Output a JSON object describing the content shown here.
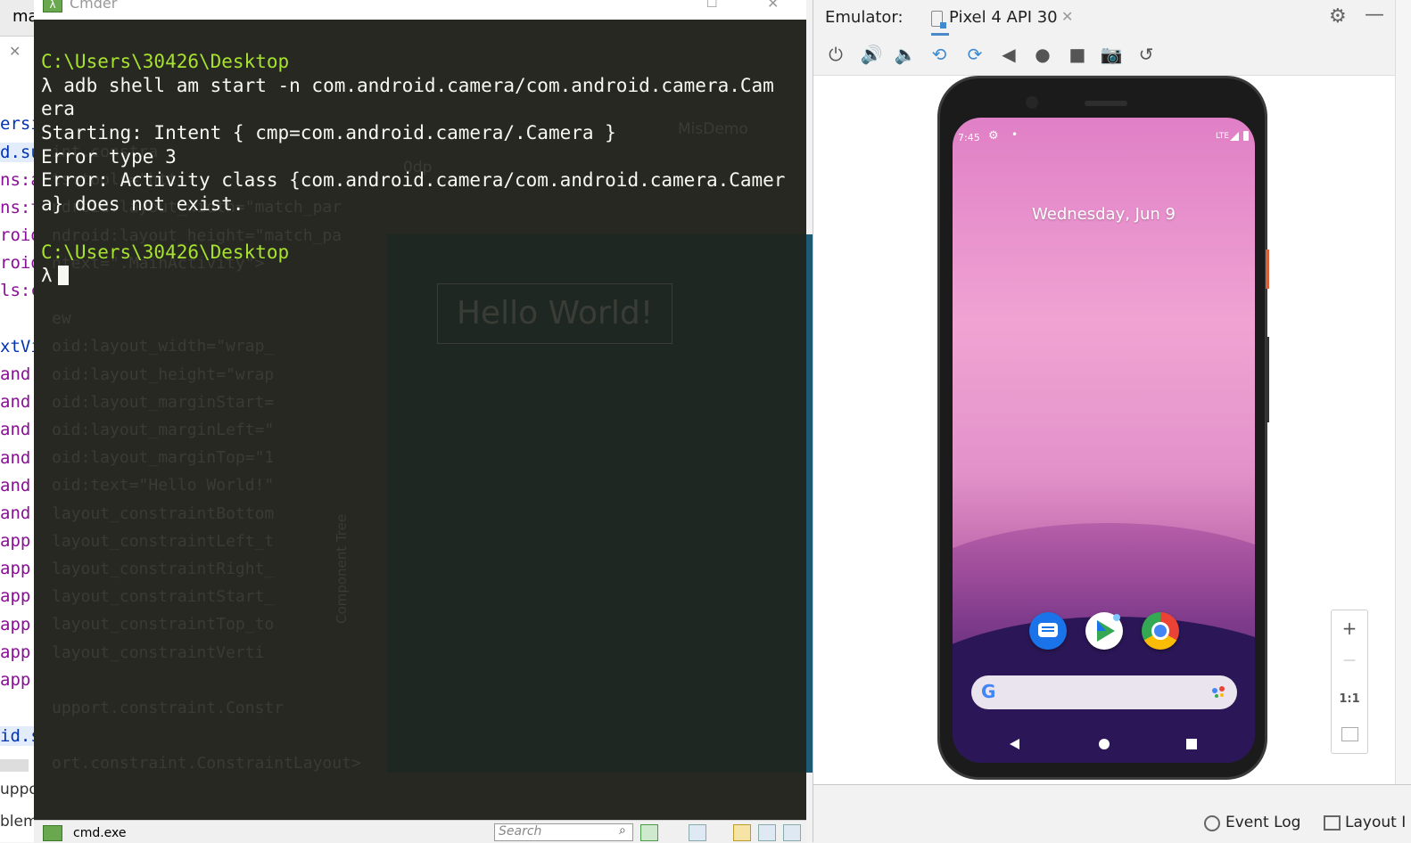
{
  "ide": {
    "tab_label": "ma",
    "tab_close": "✕",
    "code_fragments": [
      {
        "text": "ersi",
        "color": "#0033b3",
        "hl": false
      },
      {
        "text": "d.su",
        "color": "#0033b3",
        "hl": true
      },
      {
        "text": "ns:a",
        "color": "#871094",
        "hl": false
      },
      {
        "text": "ns:t",
        "color": "#871094",
        "hl": false
      },
      {
        "text": "roid",
        "color": "#871094",
        "hl": false
      },
      {
        "text": "roid",
        "color": "#871094",
        "hl": false
      },
      {
        "text": "ls:c",
        "color": "#871094",
        "hl": false
      },
      {
        "text": "",
        "color": "#000000",
        "hl": false
      },
      {
        "text": "xtVi",
        "color": "#0033b3",
        "hl": false
      },
      {
        "text": "and",
        "color": "#871094",
        "hl": false
      },
      {
        "text": "and",
        "color": "#871094",
        "hl": false
      },
      {
        "text": "and",
        "color": "#871094",
        "hl": false
      },
      {
        "text": "and",
        "color": "#871094",
        "hl": false
      },
      {
        "text": "and",
        "color": "#871094",
        "hl": false
      },
      {
        "text": "and",
        "color": "#871094",
        "hl": false
      },
      {
        "text": "app",
        "color": "#871094",
        "hl": false
      },
      {
        "text": "app",
        "color": "#871094",
        "hl": false
      },
      {
        "text": "app",
        "color": "#871094",
        "hl": false
      },
      {
        "text": "app",
        "color": "#871094",
        "hl": false
      },
      {
        "text": "app",
        "color": "#871094",
        "hl": false
      },
      {
        "text": "app",
        "color": "#871094",
        "hl": false
      },
      {
        "text": "",
        "color": "#000000",
        "hl": false
      },
      {
        "text": "id.s",
        "color": "#0033b3",
        "hl": true
      }
    ],
    "bottom_labels": [
      "uppo",
      "blems"
    ]
  },
  "cmder": {
    "title": "Cmder",
    "max_glyph": "☐",
    "close_glyph": "✕",
    "lines": [
      {
        "text": "C:\\Users\\30426\\Desktop",
        "kind": "path"
      },
      {
        "text": "λ adb shell am start -n com.android.camera/com.android.camera.Cam",
        "kind": "cmd"
      },
      {
        "text": "era",
        "kind": "cmd"
      },
      {
        "text": "Starting: Intent { cmp=com.android.camera/.Camera }",
        "kind": "out"
      },
      {
        "text": "Error type 3",
        "kind": "out"
      },
      {
        "text": "Error: Activity class {com.android.camera/com.android.camera.Camer",
        "kind": "out"
      },
      {
        "text": "a} does not exist.",
        "kind": "out"
      },
      {
        "text": "",
        "kind": "out"
      },
      {
        "text": "C:\\Users\\30426\\Desktop",
        "kind": "path"
      }
    ],
    "prompt": "λ",
    "ghost": {
      "hello": "Hello World!",
      "misdemo": "MisDemo",
      "dp": "0dp",
      "component_tree": "Component Tree",
      "code": [
        "int.constra",
        "ts:tools=\"htt",
        "ndroid:layout_width=\"match_par",
        "ndroid:layout_height=\"match_pa",
        "ntext=\".MainActivity\">",
        "",
        "ew",
        "oid:layout_width=\"wrap_",
        "oid:layout_height=\"wrap",
        "oid:layout_marginStart=",
        "oid:layout_marginLeft=\"",
        "oid:layout_marginTop=\"1",
        "oid:text=\"Hello World!\"",
        "layout_constraintBottom",
        "layout_constraintLeft_t",
        "layout_constraintRight_",
        "layout_constraintStart_",
        "layout_constraintTop_to",
        "layout_constraintVerti",
        "",
        "upport.constraint.Constr",
        "",
        "ort.constraint.ConstraintLayout>"
      ]
    },
    "status": {
      "tab_label": "cmd.exe",
      "search_placeholder": "Search"
    }
  },
  "emulator": {
    "label": "Emulator:",
    "device_tab": "Pixel 4 API 30",
    "tab_close": "✕",
    "settings_glyph": "⚙",
    "minimize_glyph": "—",
    "toolbar": [
      {
        "name": "power-icon",
        "glyph": "⏻",
        "blue": false
      },
      {
        "name": "volume-up-icon",
        "glyph": "🔊",
        "blue": false
      },
      {
        "name": "volume-down-icon",
        "glyph": "🔈",
        "blue": false
      },
      {
        "name": "rotate-left-icon",
        "glyph": "⟲",
        "blue": true
      },
      {
        "name": "rotate-right-icon",
        "glyph": "⟳",
        "blue": true
      },
      {
        "name": "back-icon",
        "glyph": "◀",
        "blue": false
      },
      {
        "name": "home-icon",
        "glyph": "●",
        "blue": false
      },
      {
        "name": "overview-icon",
        "glyph": "■",
        "blue": false
      },
      {
        "name": "camera-icon",
        "glyph": "📷",
        "blue": false
      },
      {
        "name": "snapshot-icon",
        "glyph": "↺",
        "blue": false
      }
    ],
    "phone": {
      "time": "7:45",
      "network": "LTE",
      "date": "Wednesday, Jun 9",
      "apps": [
        "messages-app-icon",
        "play-store-app-icon",
        "chrome-app-icon"
      ],
      "search_logo": "G"
    },
    "zoom": {
      "plus": "+",
      "minus": "—",
      "one_to_one": "1:1"
    }
  },
  "bottombar": {
    "event_log": "Event Log",
    "layout": "Layout I"
  }
}
